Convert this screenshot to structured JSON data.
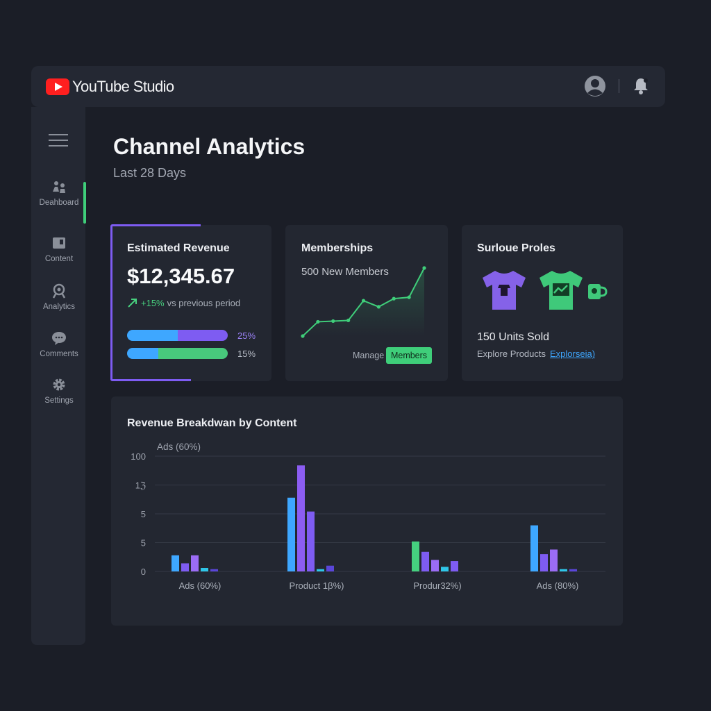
{
  "app": {
    "title": "YouTube Studio"
  },
  "colors": {
    "accent_purple": "#7e5cf2",
    "accent_green": "#3fce7a",
    "accent_blue": "#3ea7ff",
    "brand_red": "#ff1f1f"
  },
  "header": {
    "avatar_icon": "account-circle-icon",
    "bell_icon": "notification-bell-icon"
  },
  "sidebar": {
    "items": [
      {
        "label": "Deahboard",
        "icon": "dashboard-icon"
      },
      {
        "label": "Content",
        "icon": "content-icon"
      },
      {
        "label": "Analytics",
        "icon": "analytics-icon"
      },
      {
        "label": "Comments",
        "icon": "comments-icon"
      },
      {
        "label": "Settings",
        "icon": "settings-icon"
      }
    ]
  },
  "page": {
    "title": "Channel Analytics",
    "subtitle": "Last 28 Days"
  },
  "revenue": {
    "title": "Estimated Revenue",
    "value": "$12,345.67",
    "change": "+15%",
    "change_suffix": "vs previous period",
    "bars": [
      {
        "label": "25%",
        "value": 50,
        "fill": "#7e5cf2"
      },
      {
        "label": "15%",
        "value": 31,
        "fill": "#48c97c"
      }
    ]
  },
  "memberships": {
    "title": "Memberships",
    "subtitle": "500 New Members",
    "manage_label": "Manage",
    "button_label": "Members",
    "trend": [
      0,
      0.21,
      0.22,
      0.23,
      0.52,
      0.43,
      0.55,
      0.57,
      1
    ]
  },
  "merch": {
    "title": "Surloue Proles",
    "units": "150 Units Sold",
    "explore_label": "Explore Products",
    "link_label": "Explorseia)"
  },
  "chart_data": {
    "type": "bar",
    "title": "Revenue Breakdwan by Content",
    "annotation": "Ads (60%)",
    "y_ticks": [
      "100",
      "1ℨ",
      "5",
      "5",
      "0"
    ],
    "ylim": [
      0,
      100
    ],
    "categories": [
      "Ads (60%)",
      "Product 1β%)",
      "Produr32%)",
      "Ads (80%)"
    ],
    "groups": [
      [
        {
          "value": 14,
          "color": "#3ea7ff"
        },
        {
          "value": 7,
          "color": "#7e5cf2"
        },
        {
          "value": 14,
          "color": "#9b6cf5"
        },
        {
          "value": 3,
          "color": "#2fc6e8"
        },
        {
          "value": 2,
          "color": "#5a46d9"
        }
      ],
      [
        {
          "value": 64,
          "color": "#3ea7ff"
        },
        {
          "value": 92,
          "color": "#8c5df2"
        },
        {
          "value": 52,
          "color": "#7e5cf2"
        },
        {
          "value": 2,
          "color": "#2fc6e8"
        },
        {
          "value": 5,
          "color": "#5a46d9"
        }
      ],
      [
        {
          "value": 26,
          "color": "#45d07f"
        },
        {
          "value": 17,
          "color": "#7e5cf2"
        },
        {
          "value": 10,
          "color": "#9b6cf5"
        },
        {
          "value": 4,
          "color": "#2fc6e8"
        },
        {
          "value": 9,
          "color": "#7e5cf2"
        }
      ],
      [
        {
          "value": 40,
          "color": "#3ea7ff"
        },
        {
          "value": 15,
          "color": "#7e5cf2"
        },
        {
          "value": 19,
          "color": "#9b6cf5"
        },
        {
          "value": 2,
          "color": "#2fc6e8"
        },
        {
          "value": 2,
          "color": "#5a46d9"
        }
      ]
    ]
  }
}
